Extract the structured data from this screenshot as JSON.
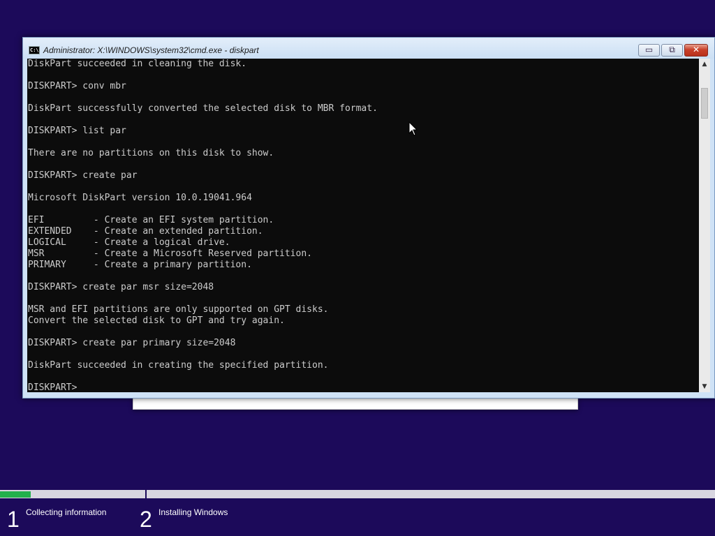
{
  "window": {
    "title": "Administrator: X:\\WINDOWS\\system32\\cmd.exe - diskpart",
    "icon_label": "C:\\",
    "minimize_symbol": "▭",
    "restore_symbol": "⧉",
    "close_symbol": "✕"
  },
  "console": {
    "lines": [
      "DiskPart succeeded in cleaning the disk.",
      "",
      "DISKPART> conv mbr",
      "",
      "DiskPart successfully converted the selected disk to MBR format.",
      "",
      "DISKPART> list par",
      "",
      "There are no partitions on this disk to show.",
      "",
      "DISKPART> create par",
      "",
      "Microsoft DiskPart version 10.0.19041.964",
      "",
      "EFI         - Create an EFI system partition.",
      "EXTENDED    - Create an extended partition.",
      "LOGICAL     - Create a logical drive.",
      "MSR         - Create a Microsoft Reserved partition.",
      "PRIMARY     - Create a primary partition.",
      "",
      "DISKPART> create par msr size=2048",
      "",
      "MSR and EFI partitions are only supported on GPT disks.",
      "Convert the selected disk to GPT and try again.",
      "",
      "DISKPART> create par primary size=2048",
      "",
      "DiskPart succeeded in creating the specified partition.",
      "",
      "DISKPART>"
    ]
  },
  "scrollbar": {
    "up_arrow": "▲",
    "down_arrow": "▼"
  },
  "setup_steps": [
    {
      "number": "1",
      "label": "Collecting information",
      "progress": 0.21
    },
    {
      "number": "2",
      "label": "Installing Windows",
      "progress": 0
    }
  ],
  "colors": {
    "desktop_background": "#1c0a5a",
    "console_background": "#0c0c0c",
    "console_text": "#cccccc",
    "progress_fill": "#22b14c"
  }
}
